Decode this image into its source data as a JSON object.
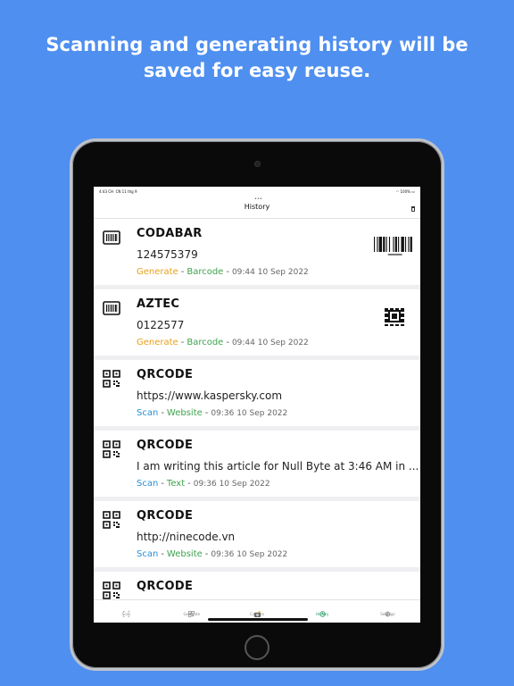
{
  "headline": {
    "line1": "Scanning and generating history will be",
    "line2": "saved for easy reuse."
  },
  "statusbar": {
    "time": "4:43 CH",
    "date": "CN 11 thg 9",
    "battery": "100%"
  },
  "navbar": {
    "title": "History",
    "grabber": "•••"
  },
  "history": [
    {
      "name": "CODABAR",
      "value": "124575379",
      "source": "Generate",
      "source_type": "generate",
      "kind": "Barcode",
      "time": "09:44 10 Sep 2022",
      "icon": "barcode-icon",
      "thumb": "barcode"
    },
    {
      "name": "AZTEC",
      "value": "0122577",
      "source": "Generate",
      "source_type": "generate",
      "kind": "Barcode",
      "time": "09:44 10 Sep 2022",
      "icon": "barcode-icon",
      "thumb": "aztec"
    },
    {
      "name": "QRCODE",
      "value": "https://www.kaspersky.com",
      "source": "Scan",
      "source_type": "scan",
      "kind": "Website",
      "time": "09:36 10 Sep 2022",
      "icon": "qrcode-icon",
      "thumb": ""
    },
    {
      "name": "QRCODE",
      "value": "I am writing this article for Null Byte at 3:46 AM in ...",
      "source": "Scan",
      "source_type": "scan",
      "kind": "Text",
      "time": "09:36 10 Sep 2022",
      "icon": "qrcode-icon",
      "thumb": ""
    },
    {
      "name": "QRCODE",
      "value": "http://ninecode.vn",
      "source": "Scan",
      "source_type": "scan",
      "kind": "Website",
      "time": "09:36 10 Sep 2022",
      "icon": "qrcode-icon",
      "thumb": ""
    },
    {
      "name": "QRCODE",
      "value": "",
      "source": "",
      "source_type": "scan",
      "kind": "",
      "time": "",
      "icon": "qrcode-icon",
      "thumb": ""
    }
  ],
  "tabs": [
    {
      "label": "Scan",
      "icon": "scan-icon",
      "active": false
    },
    {
      "label": "Generate",
      "icon": "qrcode-icon",
      "active": false
    },
    {
      "label": "Camera",
      "icon": "camera-icon",
      "active": false
    },
    {
      "label": "History",
      "icon": "history-icon",
      "active": true
    },
    {
      "label": "Settings",
      "icon": "gear-icon",
      "active": false
    }
  ],
  "colors": {
    "background": "#4f8ff0",
    "generate": "#e6a11b",
    "scan": "#2b8fd6",
    "kind": "#3fa34d",
    "active_tab": "#2a9d6a"
  }
}
